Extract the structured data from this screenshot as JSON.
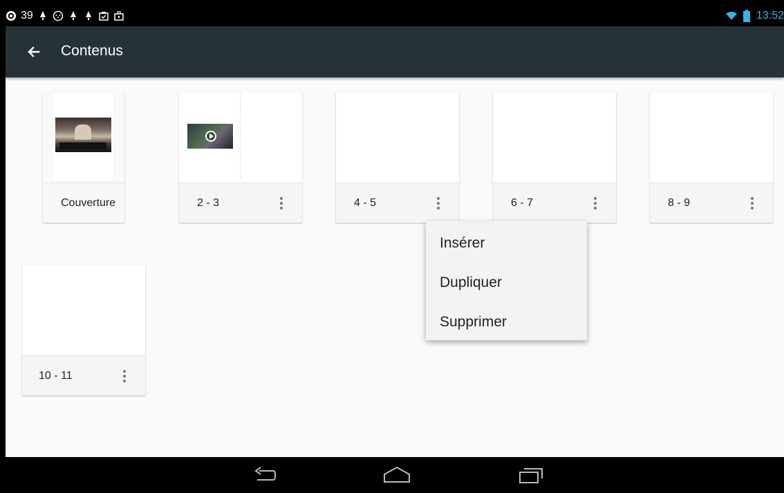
{
  "status_bar": {
    "notification_count": "39",
    "clock": "13:52",
    "icons": [
      "notification-circle-icon",
      "notification-bell-icon",
      "smiley-icon",
      "notification-bell-icon",
      "notification-bell-icon",
      "clipboard-icon",
      "briefcase-icon",
      "wifi-icon",
      "battery-icon"
    ]
  },
  "action_bar": {
    "back_icon": "arrow-left-icon",
    "title": "Contenus"
  },
  "pages": [
    {
      "label": "Couverture",
      "has_menu": false
    },
    {
      "label": "2 - 3",
      "has_menu": true
    },
    {
      "label": "4 - 5",
      "has_menu": true
    },
    {
      "label": "6 - 7",
      "has_menu": true
    },
    {
      "label": "8 - 9",
      "has_menu": true
    },
    {
      "label": "10 - 11",
      "has_menu": true
    }
  ],
  "context_menu": {
    "items": [
      "Insérer",
      "Dupliquer",
      "Supprimer"
    ]
  },
  "nav_bar": {
    "icons": [
      "back-icon",
      "home-icon",
      "recents-icon"
    ]
  },
  "colors": {
    "action_bar": "#263238",
    "clock": "#33b5e5",
    "content_bg": "#fafafa"
  }
}
